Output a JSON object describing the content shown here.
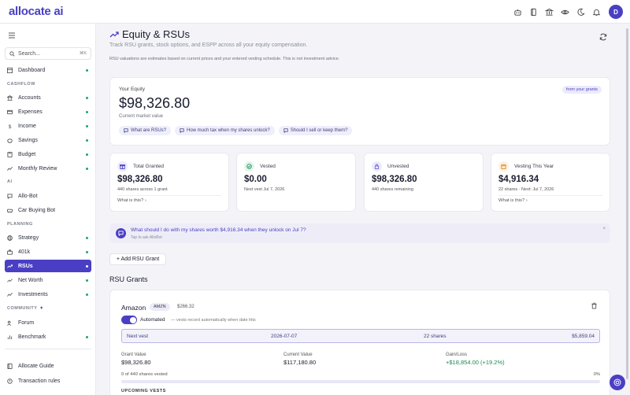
{
  "app": {
    "logo": "allocate ai",
    "avatar_initial": "D"
  },
  "top_icons": [
    "robot-icon",
    "book-icon",
    "bank-icon",
    "eye-icon",
    "moon-icon",
    "bell-icon"
  ],
  "sidebar": {
    "search_label": "Search...",
    "search_kbd": "⌘K",
    "dashboard": "Dashboard",
    "sections": {
      "cashflow": "CASHFLOW",
      "ai": "AI",
      "planning": "PLANNING",
      "community": "COMMUNITY"
    },
    "items": {
      "accounts": "Accounts",
      "expenses": "Expenses",
      "income": "Income",
      "savings": "Savings",
      "budget": "Budget",
      "monthly_review": "Monthly Review",
      "allo_bot": "Allo-Bot",
      "car_buying_bot": "Car Buying Bot",
      "strategy": "Strategy",
      "k401": "401k",
      "rsus": "RSUs",
      "net_worth": "Net Worth",
      "investments": "Investments",
      "forum": "Forum",
      "benchmark": "Benchmark"
    },
    "footer": {
      "guide": "Allocate Guide",
      "rules": "Transaction rules"
    }
  },
  "page": {
    "title": "Equity & RSUs",
    "subtitle": "Track RSU grants, stock options, and ESPP across all your equity compensation.",
    "disclaimer": "RSU valuations are estimates based on current prices and your entered vesting schedule. This is not investment advice."
  },
  "equity": {
    "label": "Your Equity",
    "value": "$98,326.80",
    "caption": "Current market value",
    "badge": "from your grants",
    "chips": [
      "What are RSUs?",
      "How much tax when my shares unlock?",
      "Should I sell or keep them?"
    ]
  },
  "stats": [
    {
      "label": "Total Granted",
      "value": "$98,326.80",
      "note": "440 shares across 1 grant",
      "link": "What is this?",
      "color": "#4a3fc4",
      "bg": "#ecebfa"
    },
    {
      "label": "Vested",
      "value": "$0.00",
      "note": "Next vest Jul 7, 2026",
      "link": "",
      "color": "#1e8a55",
      "bg": "#e3f5ec"
    },
    {
      "label": "Unvested",
      "value": "$98,326.80",
      "note": "440 shares remaining",
      "link": "",
      "color": "#6b5fd0",
      "bg": "#ecebfa"
    },
    {
      "label": "Vesting This Year",
      "value": "$4,916.34",
      "note": "22 shares · Next: Jul 7, 2026",
      "link": "What is this?",
      "color": "#d98a1e",
      "bg": "#fdf1e1"
    }
  ],
  "ask": {
    "question": "What should I do with my shares worth $4,916.34 when they unlock on Jul 7?",
    "tap": "Tap to ask AlloBot",
    "close": "×"
  },
  "add_grant_label": "+ Add RSU Grant",
  "grants_title": "RSU Grants",
  "grant": {
    "company": "Amazon",
    "ticker": "AMZN",
    "price": "$266.32",
    "automated_label": "Automated",
    "automated_note": "— vests record automatically when date hits",
    "next_vest": {
      "label": "Next vest",
      "date": "2026-07-07",
      "shares": "22 shares",
      "amount": "$5,859.04"
    },
    "grant_value": {
      "label": "Grant Value",
      "value": "$98,326.80"
    },
    "current_value": {
      "label": "Current Value",
      "value": "$117,180.80"
    },
    "gain_loss": {
      "label": "Gain/Loss",
      "value": "+$18,854.00 (+19.2%)"
    },
    "vested_text": "0 of 440 shares vested",
    "vested_pct_label": "0%",
    "vested_fraction": 0,
    "upcoming_label": "UPCOMING VESTS"
  }
}
